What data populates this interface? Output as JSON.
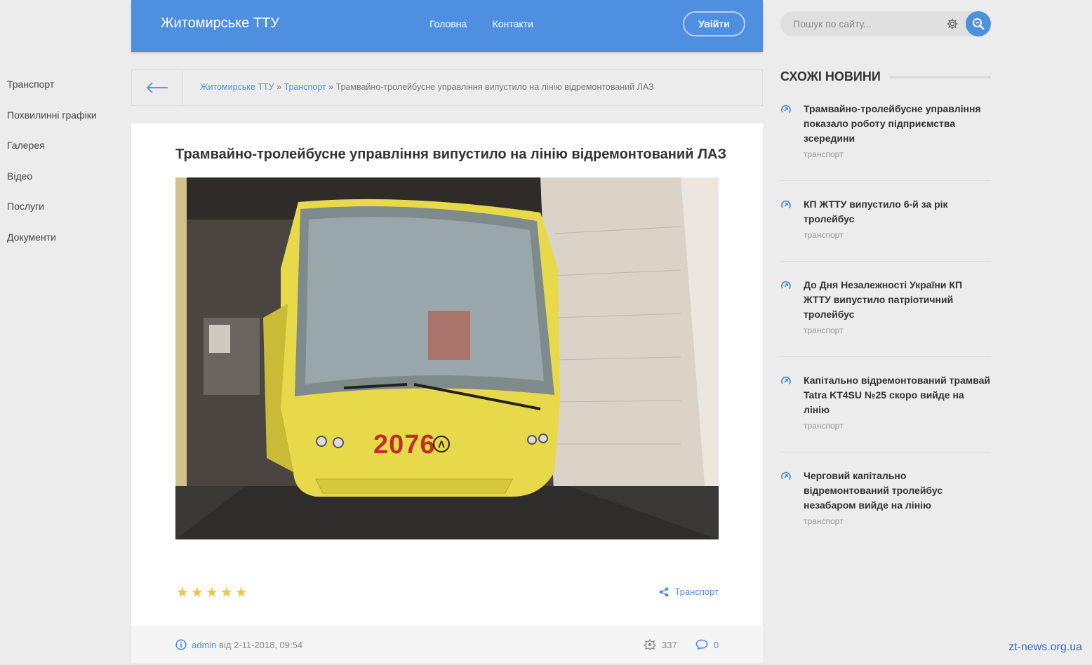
{
  "header": {
    "brand": "Житомирське ТТУ",
    "nav": [
      "Головна",
      "Контакти"
    ],
    "login": "Увійти"
  },
  "leftnav": [
    "Транспорт",
    "Похвилинні графіки",
    "Галерея",
    "Відео",
    "Послуги",
    "Документи"
  ],
  "breadcrumb": {
    "home": "Житомирське ТТУ",
    "sep1": " » ",
    "category": "Транспорт",
    "sep2": " » ",
    "current": "Трамвайно-тролейбусне управління випустило на лінію відремонтований ЛАЗ"
  },
  "article": {
    "title": "Трамвайно-тролейбусне управління випустило на лінію відремонтований ЛАЗ",
    "rating_stars": "★★★★★",
    "tag": "Транспорт",
    "author": "admin",
    "date_text": " від 2-11-2018, 09:54",
    "views": "337",
    "comments": "0",
    "photo_number": "2076"
  },
  "search": {
    "placeholder": "Пошук по сайту..."
  },
  "sidebar": {
    "title": "СХОЖІ НОВИНИ",
    "items": [
      {
        "title": "Трамвайно-тролейбусне управління показало роботу підприємства зсередини",
        "category": "транспорт"
      },
      {
        "title": "КП ЖТТУ випустило 6-й за рік тролейбус",
        "category": "транспорт"
      },
      {
        "title": "До Дня Незалежності України КП ЖТТУ випустило патріотичний тролейбус",
        "category": "транспорт"
      },
      {
        "title": "Капітально відремонтований трамвай Tatra KT4SU №25 скоро вийде на лінію",
        "category": "транспорт"
      },
      {
        "title": "Черговий капітально відремонтований тролейбус незабаром вийде на лінію",
        "category": "транспорт"
      }
    ]
  },
  "watermark": "zt-news.org.ua",
  "colors": {
    "accent": "#4e8fe0",
    "background": "#ececec",
    "star": "#f4c542"
  }
}
